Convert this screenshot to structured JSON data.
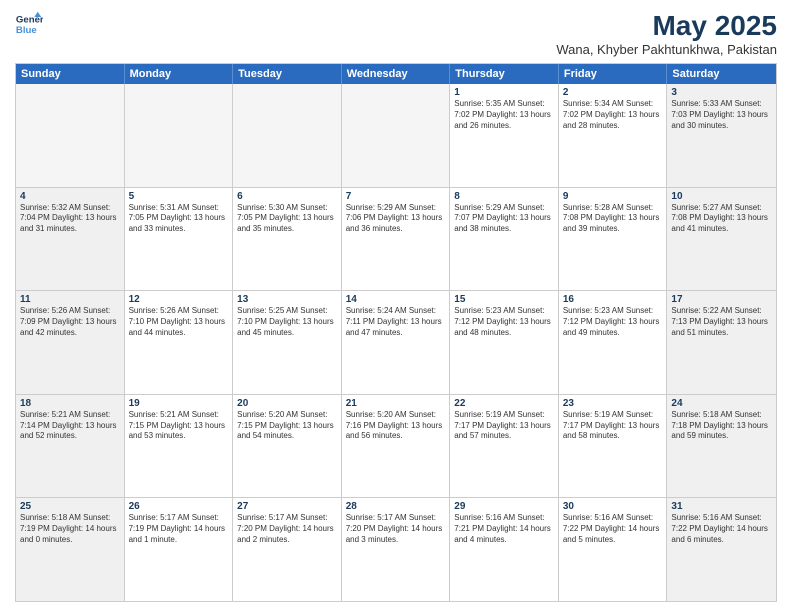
{
  "header": {
    "logo_line1": "General",
    "logo_line2": "Blue",
    "title": "May 2025",
    "subtitle": "Wana, Khyber Pakhtunkhwa, Pakistan"
  },
  "weekdays": [
    "Sunday",
    "Monday",
    "Tuesday",
    "Wednesday",
    "Thursday",
    "Friday",
    "Saturday"
  ],
  "weeks": [
    [
      {
        "day": "",
        "info": "",
        "empty": true
      },
      {
        "day": "",
        "info": "",
        "empty": true
      },
      {
        "day": "",
        "info": "",
        "empty": true
      },
      {
        "day": "",
        "info": "",
        "empty": true
      },
      {
        "day": "1",
        "info": "Sunrise: 5:35 AM\nSunset: 7:02 PM\nDaylight: 13 hours\nand 26 minutes."
      },
      {
        "day": "2",
        "info": "Sunrise: 5:34 AM\nSunset: 7:02 PM\nDaylight: 13 hours\nand 28 minutes."
      },
      {
        "day": "3",
        "info": "Sunrise: 5:33 AM\nSunset: 7:03 PM\nDaylight: 13 hours\nand 30 minutes."
      }
    ],
    [
      {
        "day": "4",
        "info": "Sunrise: 5:32 AM\nSunset: 7:04 PM\nDaylight: 13 hours\nand 31 minutes."
      },
      {
        "day": "5",
        "info": "Sunrise: 5:31 AM\nSunset: 7:05 PM\nDaylight: 13 hours\nand 33 minutes."
      },
      {
        "day": "6",
        "info": "Sunrise: 5:30 AM\nSunset: 7:05 PM\nDaylight: 13 hours\nand 35 minutes."
      },
      {
        "day": "7",
        "info": "Sunrise: 5:29 AM\nSunset: 7:06 PM\nDaylight: 13 hours\nand 36 minutes."
      },
      {
        "day": "8",
        "info": "Sunrise: 5:29 AM\nSunset: 7:07 PM\nDaylight: 13 hours\nand 38 minutes."
      },
      {
        "day": "9",
        "info": "Sunrise: 5:28 AM\nSunset: 7:08 PM\nDaylight: 13 hours\nand 39 minutes."
      },
      {
        "day": "10",
        "info": "Sunrise: 5:27 AM\nSunset: 7:08 PM\nDaylight: 13 hours\nand 41 minutes."
      }
    ],
    [
      {
        "day": "11",
        "info": "Sunrise: 5:26 AM\nSunset: 7:09 PM\nDaylight: 13 hours\nand 42 minutes."
      },
      {
        "day": "12",
        "info": "Sunrise: 5:26 AM\nSunset: 7:10 PM\nDaylight: 13 hours\nand 44 minutes."
      },
      {
        "day": "13",
        "info": "Sunrise: 5:25 AM\nSunset: 7:10 PM\nDaylight: 13 hours\nand 45 minutes."
      },
      {
        "day": "14",
        "info": "Sunrise: 5:24 AM\nSunset: 7:11 PM\nDaylight: 13 hours\nand 47 minutes."
      },
      {
        "day": "15",
        "info": "Sunrise: 5:23 AM\nSunset: 7:12 PM\nDaylight: 13 hours\nand 48 minutes."
      },
      {
        "day": "16",
        "info": "Sunrise: 5:23 AM\nSunset: 7:12 PM\nDaylight: 13 hours\nand 49 minutes."
      },
      {
        "day": "17",
        "info": "Sunrise: 5:22 AM\nSunset: 7:13 PM\nDaylight: 13 hours\nand 51 minutes."
      }
    ],
    [
      {
        "day": "18",
        "info": "Sunrise: 5:21 AM\nSunset: 7:14 PM\nDaylight: 13 hours\nand 52 minutes."
      },
      {
        "day": "19",
        "info": "Sunrise: 5:21 AM\nSunset: 7:15 PM\nDaylight: 13 hours\nand 53 minutes."
      },
      {
        "day": "20",
        "info": "Sunrise: 5:20 AM\nSunset: 7:15 PM\nDaylight: 13 hours\nand 54 minutes."
      },
      {
        "day": "21",
        "info": "Sunrise: 5:20 AM\nSunset: 7:16 PM\nDaylight: 13 hours\nand 56 minutes."
      },
      {
        "day": "22",
        "info": "Sunrise: 5:19 AM\nSunset: 7:17 PM\nDaylight: 13 hours\nand 57 minutes."
      },
      {
        "day": "23",
        "info": "Sunrise: 5:19 AM\nSunset: 7:17 PM\nDaylight: 13 hours\nand 58 minutes."
      },
      {
        "day": "24",
        "info": "Sunrise: 5:18 AM\nSunset: 7:18 PM\nDaylight: 13 hours\nand 59 minutes."
      }
    ],
    [
      {
        "day": "25",
        "info": "Sunrise: 5:18 AM\nSunset: 7:19 PM\nDaylight: 14 hours\nand 0 minutes."
      },
      {
        "day": "26",
        "info": "Sunrise: 5:17 AM\nSunset: 7:19 PM\nDaylight: 14 hours\nand 1 minute."
      },
      {
        "day": "27",
        "info": "Sunrise: 5:17 AM\nSunset: 7:20 PM\nDaylight: 14 hours\nand 2 minutes."
      },
      {
        "day": "28",
        "info": "Sunrise: 5:17 AM\nSunset: 7:20 PM\nDaylight: 14 hours\nand 3 minutes."
      },
      {
        "day": "29",
        "info": "Sunrise: 5:16 AM\nSunset: 7:21 PM\nDaylight: 14 hours\nand 4 minutes."
      },
      {
        "day": "30",
        "info": "Sunrise: 5:16 AM\nSunset: 7:22 PM\nDaylight: 14 hours\nand 5 minutes."
      },
      {
        "day": "31",
        "info": "Sunrise: 5:16 AM\nSunset: 7:22 PM\nDaylight: 14 hours\nand 6 minutes."
      }
    ]
  ]
}
